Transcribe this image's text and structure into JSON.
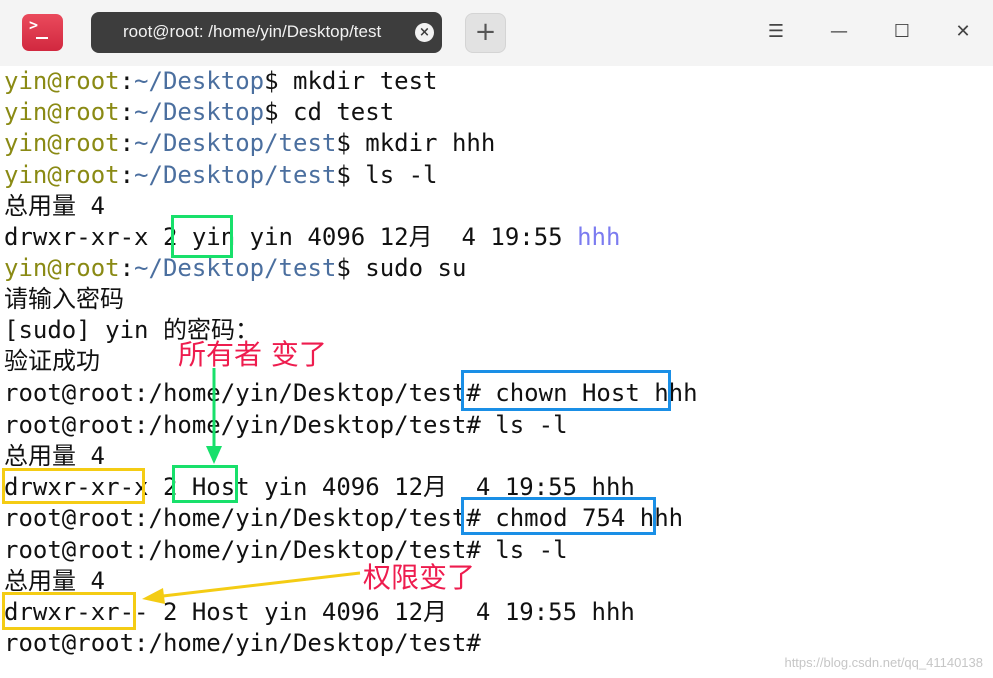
{
  "window": {
    "tab_title": "root@root: /home/yin/Desktop/test",
    "tab_close": "×",
    "new_tab": "+",
    "menu_glyph": "☰",
    "minimize_glyph": "—",
    "maximize_glyph": "☐",
    "close_glyph": "✕",
    "app_icon_glyph": ">"
  },
  "terminal": {
    "l1": {
      "user": "yin@root",
      "path": "~/Desktop",
      "cmd": "$ mkdir test"
    },
    "l2": {
      "user": "yin@root",
      "path": "~/Desktop",
      "cmd": "$ cd test"
    },
    "l3": {
      "user": "yin@root",
      "path": "~/Desktop/test",
      "cmd": "$ mkdir hhh"
    },
    "l4": {
      "user": "yin@root",
      "path": "~/Desktop/test",
      "cmd": "$ ls -l"
    },
    "l5": "总用量 4",
    "l6": {
      "text": "drwxr-xr-x 2 yin yin 4096 12月  4 19:55 ",
      "dir": "hhh"
    },
    "l7": {
      "user": "yin@root",
      "path": "~/Desktop/test",
      "cmd": "$ sudo su"
    },
    "l8": "请输入密码",
    "l9": "[sudo] yin 的密码：",
    "l10": "验证成功",
    "l11": "root@root:/home/yin/Desktop/test# chown Host hhh",
    "l12": "root@root:/home/yin/Desktop/test# ls -l",
    "l13": "总用量 4",
    "l14": "drwxr-xr-x 2 Host yin 4096 12月  4 19:55 hhh",
    "l15": "root@root:/home/yin/Desktop/test# chmod 754 hhh",
    "l16": "root@root:/home/yin/Desktop/test# ls -l",
    "l17": "总用量 4",
    "l18": "drwxr-xr-- 2 Host yin 4096 12月  4 19:55 hhh",
    "l19": "root@root:/home/yin/Desktop/test#"
  },
  "annotations": {
    "owner_changed": "所有者 变了",
    "perm_changed": "权限变了",
    "green_color": "#18e06b",
    "blue_color": "#1a8fe6",
    "yellow_color": "#f4cc14",
    "text_color": "#ee1c4e"
  },
  "watermark": "https://blog.csdn.net/qq_41140138"
}
